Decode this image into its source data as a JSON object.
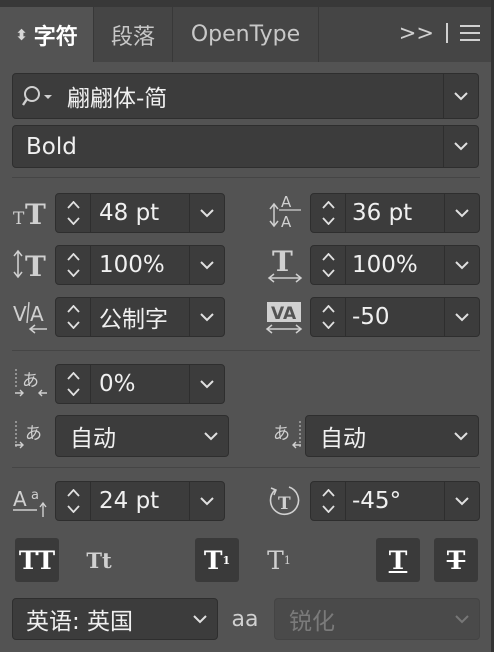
{
  "tabs": [
    {
      "label": "字符",
      "active": true
    },
    {
      "label": "段落",
      "active": false
    },
    {
      "label": "OpenType",
      "active": false
    }
  ],
  "tab_menu": {
    "expand_label": ">>"
  },
  "font": {
    "family": "翩翩体-简",
    "style": "Bold"
  },
  "fields": {
    "font_size": "48 pt",
    "leading": "36 pt",
    "vertical_scale": "100%",
    "horizontal_scale": "100%",
    "kerning": "公制字",
    "tracking": "-50",
    "tsume": "0%",
    "aki_left": "自动",
    "aki_right": "自动",
    "baseline_shift": "24 pt",
    "rotation": "-45°"
  },
  "glyph_buttons": [
    {
      "name": "all-caps",
      "label": "TT",
      "on": true
    },
    {
      "name": "small-caps",
      "label": "Tt",
      "on": false
    },
    {
      "name": "superscript",
      "label": "T",
      "on": true
    },
    {
      "name": "subscript",
      "label": "T",
      "on": false
    },
    {
      "name": "underline",
      "label": "T",
      "on": true
    },
    {
      "name": "strikethrough",
      "label": "T",
      "on": true
    }
  ],
  "language": "英语: 英国",
  "anti_alias": {
    "icon_label": "aa",
    "value": "锐化",
    "enabled": false
  },
  "colors": {
    "panel": "#535353",
    "field": "#3c3c3c",
    "tabbar": "#454545",
    "text": "#ececec"
  }
}
